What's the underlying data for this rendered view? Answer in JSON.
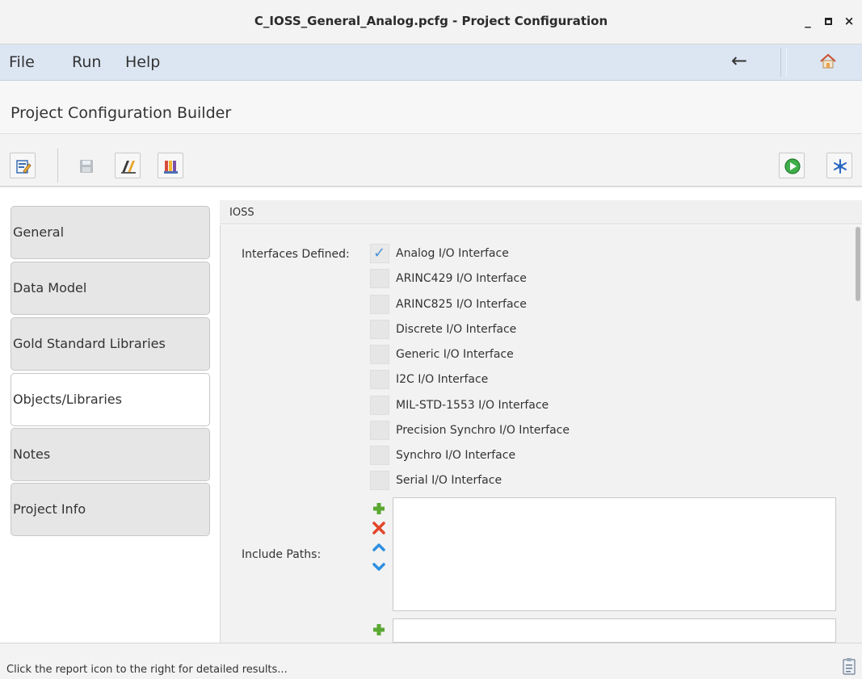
{
  "window": {
    "title": "C_IOSS_General_Analog.pcfg - Project Configuration",
    "minimize_glyph": "_",
    "close_glyph": "×"
  },
  "menubar": {
    "items": [
      "File",
      "Run",
      "Help"
    ],
    "back_glyph": "←"
  },
  "header": {
    "title": "Project Configuration Builder"
  },
  "toolbar": {
    "icons": [
      "edit-config-icon",
      "save-icon",
      "report-icon",
      "library-icon",
      "run-icon",
      "settings-snowflake-icon"
    ]
  },
  "sidebar": {
    "tabs": [
      {
        "label": "General",
        "active": false
      },
      {
        "label": "Data Model",
        "active": false
      },
      {
        "label": "Gold Standard Libraries",
        "active": false
      },
      {
        "label": "Objects/Libraries",
        "active": true
      },
      {
        "label": "Notes",
        "active": false
      },
      {
        "label": "Project Info",
        "active": false
      }
    ]
  },
  "panel": {
    "title": "IOSS",
    "interfaces_label": "Interfaces Defined:",
    "interfaces": [
      {
        "label": "Analog I/O Interface",
        "checked": true
      },
      {
        "label": "ARINC429 I/O Interface",
        "checked": false
      },
      {
        "label": "ARINC825 I/O Interface",
        "checked": false
      },
      {
        "label": "Discrete I/O Interface",
        "checked": false
      },
      {
        "label": "Generic I/O Interface",
        "checked": false
      },
      {
        "label": "I2C I/O Interface",
        "checked": false
      },
      {
        "label": "MIL-STD-1553 I/O Interface",
        "checked": false
      },
      {
        "label": "Precision Synchro I/O Interface",
        "checked": false
      },
      {
        "label": "Synchro I/O Interface",
        "checked": false
      },
      {
        "label": "Serial I/O Interface",
        "checked": false
      }
    ],
    "include_paths_label": "Include Paths:",
    "include_paths": [],
    "include_path_input": ""
  },
  "statusbar": {
    "message": "Click the report icon to the right for detailed results..."
  },
  "colors": {
    "menubar_bg": "#dce6f2",
    "check": "#4a8fd6",
    "add_green": "#5aa832",
    "remove_red": "#e2452b",
    "arrow_blue": "#2e8fe0",
    "run_green": "#3fae49"
  }
}
